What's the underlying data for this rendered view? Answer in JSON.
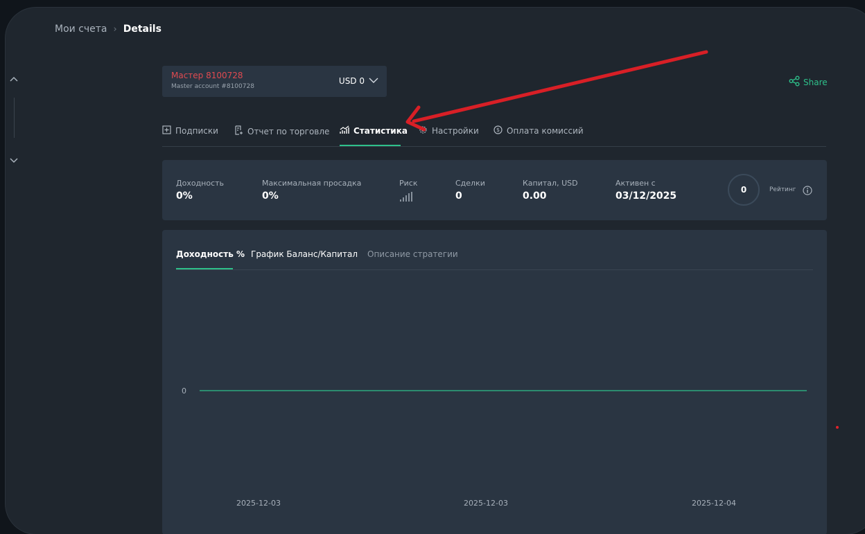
{
  "breadcrumb": {
    "parent": "Мои счета",
    "separator": "›",
    "current": "Details"
  },
  "account": {
    "name": "Мастер 8100728",
    "subtitle": "Master account #8100728",
    "balance": "USD 0"
  },
  "share_label": "Share",
  "tabs": [
    {
      "label": "Подписки",
      "icon": "plus-square-icon"
    },
    {
      "label": "Отчет по торговле",
      "icon": "report-icon"
    },
    {
      "label": "Статистика",
      "icon": "chart-icon",
      "active": true
    },
    {
      "label": "Настройки",
      "icon": "gear-icon"
    },
    {
      "label": "Оплата комиссий",
      "icon": "dollar-circle-icon"
    }
  ],
  "stats": {
    "yield_label": "Доходность",
    "yield_value": "0%",
    "drawdown_label": "Максимальная просадка",
    "drawdown_value": "0%",
    "risk_label": "Риск",
    "deals_label": "Сделки",
    "deals_value": "0",
    "capital_label": "Капитал, USD",
    "capital_value": "0.00",
    "active_label": "Активен с",
    "active_value": "03/12/2025",
    "rating_value": "0",
    "rating_label": "Рейтинг"
  },
  "chart_tabs": [
    "Доходность %",
    "График Баланс/Капитал",
    "Описание стратегии"
  ],
  "colors": {
    "accent": "#2ec08a",
    "account_name": "#e04a50",
    "annotation_arrow": "#d81f26"
  },
  "chart_data": {
    "type": "line",
    "x": [
      "2025-12-03",
      "2025-12-03",
      "2025-12-04"
    ],
    "series": [
      {
        "values": [
          0,
          0,
          0
        ]
      }
    ],
    "y_ticks": [
      "0"
    ],
    "x_ticks": [
      "2025-12-03",
      "2025-12-03",
      "2025-12-04"
    ],
    "line_color": "#2ec08a"
  }
}
